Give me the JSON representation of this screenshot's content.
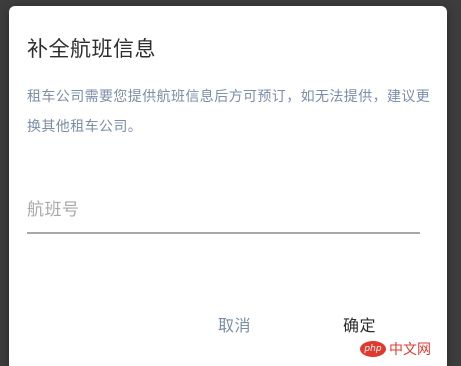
{
  "dialog": {
    "title": "补全航班信息",
    "description": "租车公司需要您提供航班信息后方可预订，如无法提供，建议更换其他租车公司。",
    "flight_input": {
      "placeholder": "航班号",
      "value": ""
    },
    "buttons": {
      "cancel_label": "取消",
      "confirm_label": "确定"
    }
  },
  "watermark": {
    "logo_text": "php",
    "site_text": "中文网"
  },
  "colors": {
    "overlay": "#3d3d3d",
    "dialog_bg": "#ffffff",
    "title": "#2e2e2e",
    "description": "#7a8ea6",
    "input_underline": "#a8a8a8",
    "cancel": "#7a8ea6",
    "confirm": "#2e2e2e"
  }
}
